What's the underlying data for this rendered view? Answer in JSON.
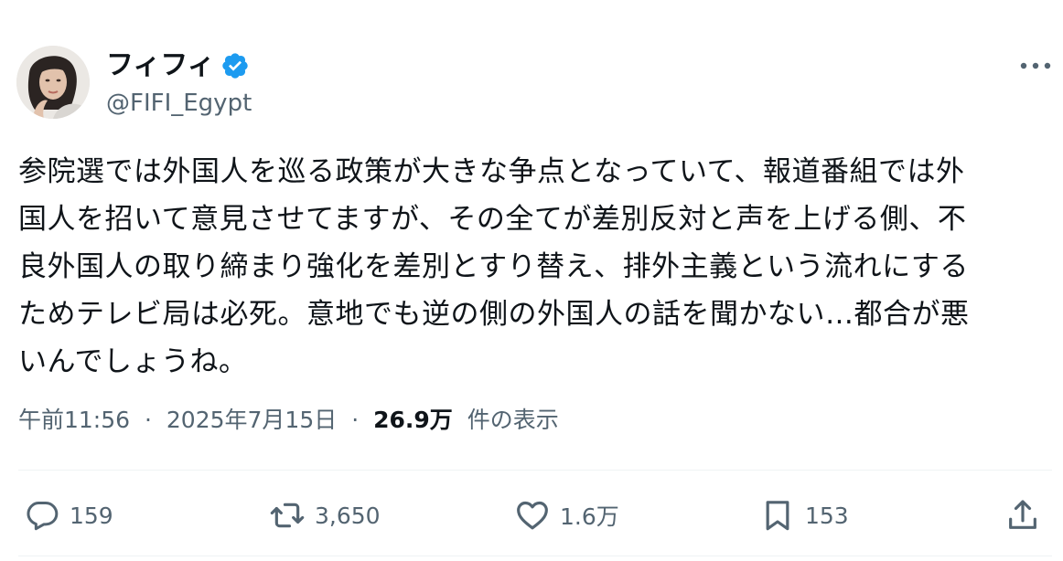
{
  "author": {
    "display_name": "フィフィ",
    "handle": "@FIFI_Egypt",
    "verified": true,
    "verified_color": "#1d9bf0"
  },
  "tweet": {
    "text_lines": [
      "参院選では外国人を巡る政策が大きな争点となっていて、報道番組では外",
      "国人を招いて意見させてますが、その全てが差別反対と声を上げる側、不",
      "良外国人の取り締まり強化を差別とすり替え、排外主義という流れにする",
      "ためテレビ局は必死。意地でも逆の側の外国人の話を聞かない…都合が悪",
      "いんでしょうね。"
    ],
    "time": "午前11:56",
    "separator": "·",
    "date": "2025年7月15日",
    "views_count": "26.9万",
    "views_label": "件の表示"
  },
  "actions": {
    "reply": {
      "icon": "reply-icon",
      "count": "159"
    },
    "retweet": {
      "icon": "retweet-icon",
      "count": "3,650"
    },
    "like": {
      "icon": "heart-icon",
      "count": "1.6万"
    },
    "bookmark": {
      "icon": "bookmark-icon",
      "count": "153"
    },
    "share": {
      "icon": "share-icon"
    }
  },
  "colors": {
    "text": "#0f1419",
    "secondary": "#536471",
    "divider": "#eff3f4"
  }
}
